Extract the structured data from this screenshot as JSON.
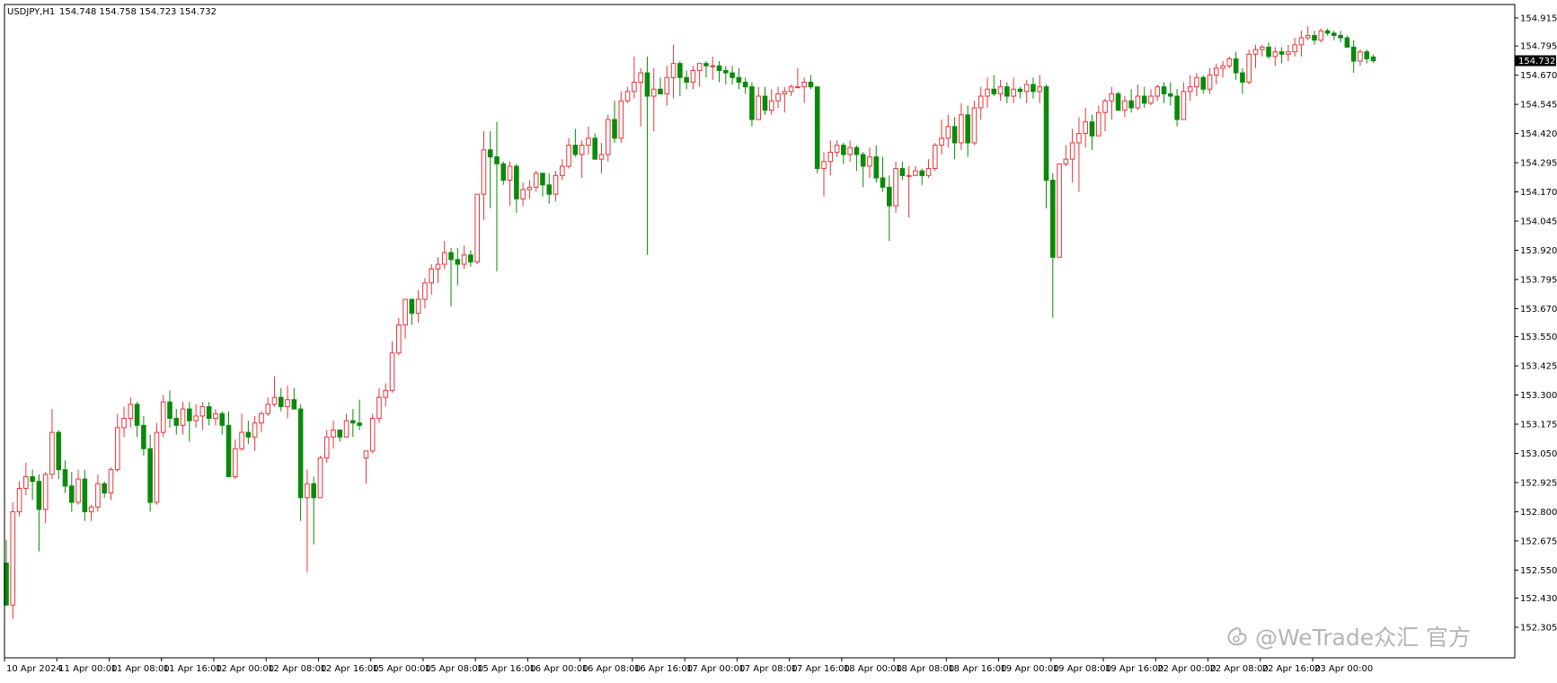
{
  "header": {
    "symbol": "USDJPY,H1",
    "ohlc": "154.748 154.758 154.723 154.732"
  },
  "watermark": {
    "text": "@WeTrade众汇 官方"
  },
  "colors": {
    "bull": "#e8343a",
    "bear": "#0a8a0a",
    "axis": "#000000",
    "tag_bg": "#000000"
  },
  "chart_data": {
    "type": "candlestick",
    "symbol": "USDJPY",
    "timeframe": "H1",
    "current_price": 154.732,
    "price_tag": "154.732",
    "ylim": [
      152.34,
      154.96
    ],
    "y_ticks": [
      "154.915",
      "154.795",
      "154.670",
      "154.545",
      "154.420",
      "154.295",
      "154.170",
      "154.045",
      "153.920",
      "153.795",
      "153.670",
      "153.550",
      "153.425",
      "153.300",
      "153.175",
      "153.050",
      "152.925",
      "152.800",
      "152.675",
      "152.550",
      "152.430",
      "152.305"
    ],
    "x_labels": [
      "10 Apr 2024",
      "11 Apr 00:00",
      "11 Apr 08:00",
      "11 Apr 16:00",
      "12 Apr 00:00",
      "12 Apr 08:00",
      "12 Apr 16:00",
      "15 Apr 00:00",
      "15 Apr 08:00",
      "15 Apr 16:00",
      "16 Apr 00:00",
      "16 Apr 08:00",
      "16 Apr 16:00",
      "17 Apr 00:00",
      "17 Apr 08:00",
      "17 Apr 16:00",
      "18 Apr 00:00",
      "18 Apr 08:00",
      "18 Apr 16:00",
      "19 Apr 00:00",
      "19 Apr 08:00",
      "19 Apr 16:00",
      "22 Apr 00:00",
      "22 Apr 08:00",
      "22 Apr 16:00",
      "23 Apr 00:00"
    ],
    "candles": [
      [
        152.58,
        152.68,
        152.4,
        152.4
      ],
      [
        152.4,
        152.84,
        152.34,
        152.8
      ],
      [
        152.8,
        152.93,
        152.78,
        152.9
      ],
      [
        152.9,
        153.01,
        152.87,
        152.95
      ],
      [
        152.95,
        152.98,
        152.85,
        152.93
      ],
      [
        152.93,
        152.96,
        152.63,
        152.81
      ],
      [
        152.81,
        152.97,
        152.75,
        152.96
      ],
      [
        152.96,
        153.24,
        152.94,
        153.14
      ],
      [
        153.14,
        153.15,
        152.94,
        152.98
      ],
      [
        152.98,
        153.02,
        152.88,
        152.91
      ],
      [
        152.91,
        152.97,
        152.8,
        152.84
      ],
      [
        152.84,
        152.98,
        152.83,
        152.94
      ],
      [
        152.94,
        152.98,
        152.76,
        152.8
      ],
      [
        152.8,
        152.83,
        152.76,
        152.82
      ],
      [
        152.82,
        152.96,
        152.8,
        152.92
      ],
      [
        152.92,
        152.93,
        152.86,
        152.88
      ],
      [
        152.88,
        152.99,
        152.85,
        152.98
      ],
      [
        152.98,
        153.22,
        152.97,
        153.16
      ],
      [
        153.16,
        153.25,
        153.12,
        153.2
      ],
      [
        153.2,
        153.29,
        153.16,
        153.26
      ],
      [
        153.26,
        153.27,
        153.12,
        153.17
      ],
      [
        153.17,
        153.21,
        153.04,
        153.07
      ],
      [
        153.07,
        153.13,
        152.8,
        152.84
      ],
      [
        152.84,
        153.18,
        152.83,
        153.14
      ],
      [
        153.14,
        153.3,
        153.12,
        153.27
      ],
      [
        153.27,
        153.32,
        153.16,
        153.2
      ],
      [
        153.2,
        153.24,
        153.13,
        153.17
      ],
      [
        153.17,
        153.27,
        153.13,
        153.24
      ],
      [
        153.24,
        153.27,
        153.1,
        153.19
      ],
      [
        153.19,
        153.26,
        153.16,
        153.21
      ],
      [
        153.21,
        153.27,
        153.15,
        153.25
      ],
      [
        153.25,
        153.27,
        153.17,
        153.2
      ],
      [
        153.2,
        153.24,
        153.17,
        153.22
      ],
      [
        153.22,
        153.23,
        153.13,
        153.17
      ],
      [
        153.17,
        153.23,
        152.95,
        152.95
      ],
      [
        152.95,
        153.11,
        152.94,
        153.07
      ],
      [
        153.07,
        153.22,
        153.06,
        153.14
      ],
      [
        153.14,
        153.19,
        153.09,
        153.12
      ],
      [
        153.12,
        153.21,
        153.06,
        153.18
      ],
      [
        153.18,
        153.23,
        153.14,
        153.22
      ],
      [
        153.22,
        153.29,
        153.21,
        153.26
      ],
      [
        153.26,
        153.38,
        153.25,
        153.29
      ],
      [
        153.29,
        153.33,
        153.23,
        153.25
      ],
      [
        153.25,
        153.34,
        153.2,
        153.28
      ],
      [
        153.28,
        153.33,
        153.24,
        153.24
      ],
      [
        153.24,
        153.26,
        152.76,
        152.86
      ],
      [
        152.86,
        152.98,
        152.54,
        152.92
      ],
      [
        152.92,
        152.95,
        152.66,
        152.86
      ],
      [
        152.86,
        153.04,
        152.86,
        153.03
      ],
      [
        153.03,
        153.15,
        153.01,
        153.12
      ],
      [
        153.12,
        153.19,
        153.07,
        153.15
      ],
      [
        153.15,
        153.14,
        153.1,
        153.12
      ],
      [
        153.12,
        153.22,
        153.12,
        153.19
      ],
      [
        153.19,
        153.24,
        153.12,
        153.18
      ],
      [
        153.18,
        153.28,
        153.15,
        153.17
      ],
      [
        153.03,
        153.06,
        152.92,
        153.06
      ],
      [
        153.06,
        153.22,
        153.05,
        153.2
      ],
      [
        153.2,
        153.33,
        153.18,
        153.29
      ],
      [
        153.29,
        153.35,
        153.25,
        153.32
      ],
      [
        153.32,
        153.53,
        153.31,
        153.48
      ],
      [
        153.48,
        153.63,
        153.47,
        153.6
      ],
      [
        153.6,
        153.71,
        153.54,
        153.71
      ],
      [
        153.71,
        153.7,
        153.6,
        153.65
      ],
      [
        153.65,
        153.75,
        153.61,
        153.71
      ],
      [
        153.71,
        153.8,
        153.67,
        153.78
      ],
      [
        153.78,
        153.86,
        153.73,
        153.84
      ],
      [
        153.84,
        153.89,
        153.78,
        153.86
      ],
      [
        153.86,
        153.96,
        153.84,
        153.91
      ],
      [
        153.91,
        153.93,
        153.68,
        153.88
      ],
      [
        153.88,
        153.93,
        153.77,
        153.86
      ],
      [
        153.86,
        153.94,
        153.84,
        153.9
      ],
      [
        153.9,
        153.92,
        153.85,
        153.87
      ],
      [
        153.87,
        154.16,
        153.86,
        154.16
      ],
      [
        154.16,
        154.43,
        154.05,
        154.35
      ],
      [
        154.35,
        154.43,
        154.1,
        154.32
      ],
      [
        154.32,
        154.47,
        153.83,
        154.29
      ],
      [
        154.29,
        154.3,
        154.2,
        154.22
      ],
      [
        154.22,
        154.3,
        154.11,
        154.28
      ],
      [
        154.28,
        154.29,
        154.08,
        154.14
      ],
      [
        154.14,
        154.21,
        154.11,
        154.18
      ],
      [
        154.18,
        154.22,
        154.14,
        154.19
      ],
      [
        154.19,
        154.26,
        154.17,
        154.25
      ],
      [
        154.25,
        154.25,
        154.15,
        154.2
      ],
      [
        154.2,
        154.25,
        154.12,
        154.16
      ],
      [
        154.16,
        154.26,
        154.13,
        154.24
      ],
      [
        154.24,
        154.31,
        154.22,
        154.28
      ],
      [
        154.28,
        154.4,
        154.27,
        154.37
      ],
      [
        154.37,
        154.44,
        154.32,
        154.33
      ],
      [
        154.33,
        154.39,
        154.23,
        154.37
      ],
      [
        154.37,
        154.45,
        154.33,
        154.4
      ],
      [
        154.4,
        154.42,
        154.31,
        154.31
      ],
      [
        154.31,
        154.38,
        154.25,
        154.33
      ],
      [
        154.33,
        154.5,
        154.3,
        154.48
      ],
      [
        154.48,
        154.56,
        154.38,
        154.4
      ],
      [
        154.4,
        154.6,
        154.38,
        154.56
      ],
      [
        154.56,
        154.62,
        154.55,
        154.6
      ],
      [
        154.6,
        154.75,
        154.57,
        154.64
      ],
      [
        154.64,
        154.7,
        154.45,
        154.68
      ],
      [
        154.68,
        154.75,
        153.9,
        154.58
      ],
      [
        154.58,
        154.7,
        154.43,
        154.61
      ],
      [
        154.61,
        154.66,
        154.59,
        154.59
      ],
      [
        154.59,
        154.71,
        154.54,
        154.66
      ],
      [
        154.66,
        154.8,
        154.57,
        154.72
      ],
      [
        154.72,
        154.73,
        154.58,
        154.66
      ],
      [
        154.66,
        154.69,
        154.61,
        154.64
      ],
      [
        154.64,
        154.71,
        154.61,
        154.69
      ],
      [
        154.69,
        154.72,
        154.62,
        154.72
      ],
      [
        154.72,
        154.73,
        154.66,
        154.71
      ],
      [
        154.71,
        154.75,
        154.65,
        154.71
      ],
      [
        154.71,
        154.73,
        154.64,
        154.69
      ],
      [
        154.69,
        154.71,
        154.63,
        154.68
      ],
      [
        154.68,
        154.71,
        154.63,
        154.66
      ],
      [
        154.66,
        154.7,
        154.61,
        154.64
      ],
      [
        154.64,
        154.66,
        154.59,
        154.62
      ],
      [
        154.62,
        154.64,
        154.45,
        154.48
      ],
      [
        154.48,
        154.62,
        154.48,
        154.58
      ],
      [
        154.58,
        154.62,
        154.5,
        154.52
      ],
      [
        154.52,
        154.61,
        154.5,
        154.56
      ],
      [
        154.56,
        154.62,
        154.53,
        154.59
      ],
      [
        154.59,
        154.62,
        154.51,
        154.6
      ],
      [
        154.6,
        154.63,
        154.58,
        154.62
      ],
      [
        154.62,
        154.7,
        154.62,
        154.62
      ],
      [
        154.62,
        154.66,
        154.55,
        154.64
      ],
      [
        154.64,
        154.67,
        154.61,
        154.62
      ],
      [
        154.62,
        154.62,
        154.25,
        154.27
      ],
      [
        154.27,
        154.34,
        154.15,
        154.3
      ],
      [
        154.3,
        154.39,
        154.24,
        154.34
      ],
      [
        154.34,
        154.39,
        154.32,
        154.37
      ],
      [
        154.37,
        154.38,
        154.29,
        154.33
      ],
      [
        154.33,
        154.39,
        154.3,
        154.36
      ],
      [
        154.36,
        154.37,
        154.26,
        154.33
      ],
      [
        154.33,
        154.34,
        154.19,
        154.28
      ],
      [
        154.28,
        154.36,
        154.23,
        154.32
      ],
      [
        154.32,
        154.37,
        154.21,
        154.23
      ],
      [
        154.23,
        154.32,
        154.17,
        154.19
      ],
      [
        154.19,
        154.24,
        153.96,
        154.11
      ],
      [
        154.11,
        154.3,
        154.08,
        154.27
      ],
      [
        154.27,
        154.3,
        154.22,
        154.24
      ],
      [
        154.24,
        154.28,
        154.06,
        154.24
      ],
      [
        154.24,
        154.28,
        154.24,
        154.26
      ],
      [
        154.26,
        154.27,
        154.2,
        154.24
      ],
      [
        154.24,
        154.31,
        154.23,
        154.27
      ],
      [
        154.27,
        154.38,
        154.26,
        154.37
      ],
      [
        154.37,
        154.48,
        154.33,
        154.4
      ],
      [
        154.4,
        154.5,
        154.36,
        154.45
      ],
      [
        154.45,
        154.49,
        154.31,
        154.38
      ],
      [
        154.38,
        154.55,
        154.35,
        154.5
      ],
      [
        154.5,
        154.54,
        154.32,
        154.38
      ],
      [
        154.38,
        154.56,
        154.37,
        154.53
      ],
      [
        154.53,
        154.62,
        154.48,
        154.58
      ],
      [
        154.58,
        154.66,
        154.53,
        154.61
      ],
      [
        154.61,
        154.67,
        154.58,
        154.59
      ],
      [
        154.59,
        154.65,
        154.56,
        154.62
      ],
      [
        154.62,
        154.64,
        154.55,
        154.58
      ],
      [
        154.58,
        154.66,
        154.55,
        154.61
      ],
      [
        154.61,
        154.62,
        154.57,
        154.6
      ],
      [
        154.6,
        154.65,
        154.55,
        154.63
      ],
      [
        154.63,
        154.66,
        154.57,
        154.6
      ],
      [
        154.6,
        154.67,
        154.55,
        154.62
      ],
      [
        154.62,
        154.63,
        154.1,
        154.22
      ],
      [
        154.22,
        154.25,
        153.63,
        153.89
      ],
      [
        153.89,
        154.29,
        153.89,
        154.29
      ],
      [
        154.29,
        154.37,
        154.28,
        154.31
      ],
      [
        154.31,
        154.44,
        154.21,
        154.38
      ],
      [
        154.38,
        154.49,
        154.17,
        154.42
      ],
      [
        154.42,
        154.53,
        154.36,
        154.47
      ],
      [
        154.47,
        154.5,
        154.35,
        154.41
      ],
      [
        154.41,
        154.54,
        154.41,
        154.51
      ],
      [
        154.51,
        154.57,
        154.43,
        154.56
      ],
      [
        154.56,
        154.62,
        154.48,
        154.59
      ],
      [
        154.59,
        154.6,
        154.52,
        154.52
      ],
      [
        154.52,
        154.58,
        154.49,
        154.56
      ],
      [
        154.56,
        154.61,
        154.51,
        154.53
      ],
      [
        154.53,
        154.63,
        154.52,
        154.58
      ],
      [
        154.58,
        154.62,
        154.53,
        154.55
      ],
      [
        154.55,
        154.61,
        154.54,
        154.58
      ],
      [
        154.58,
        154.63,
        154.56,
        154.62
      ],
      [
        154.62,
        154.64,
        154.55,
        154.59
      ],
      [
        154.59,
        154.64,
        154.54,
        154.58
      ],
      [
        154.58,
        154.61,
        154.45,
        154.48
      ],
      [
        154.48,
        154.64,
        154.48,
        154.6
      ],
      [
        154.6,
        154.67,
        154.56,
        154.62
      ],
      [
        154.62,
        154.68,
        154.58,
        154.66
      ],
      [
        154.66,
        154.67,
        154.59,
        154.61
      ],
      [
        154.61,
        154.7,
        154.59,
        154.67
      ],
      [
        154.67,
        154.72,
        154.63,
        154.7
      ],
      [
        154.7,
        154.73,
        154.66,
        154.71
      ],
      [
        154.71,
        154.75,
        154.7,
        154.74
      ],
      [
        154.74,
        154.77,
        154.65,
        154.68
      ],
      [
        154.68,
        154.7,
        154.59,
        154.64
      ],
      [
        154.64,
        154.78,
        154.63,
        154.76
      ],
      [
        154.76,
        154.8,
        154.7,
        154.78
      ],
      [
        154.78,
        154.8,
        154.75,
        154.79
      ],
      [
        154.79,
        154.81,
        154.74,
        154.75
      ],
      [
        154.75,
        154.79,
        154.71,
        154.77
      ],
      [
        154.77,
        154.79,
        154.72,
        154.76
      ],
      [
        154.76,
        154.8,
        154.73,
        154.77
      ],
      [
        154.77,
        154.83,
        154.75,
        154.8
      ],
      [
        154.8,
        154.86,
        154.75,
        154.83
      ],
      [
        154.83,
        154.88,
        154.82,
        154.84
      ],
      [
        154.84,
        154.86,
        154.8,
        154.82
      ],
      [
        154.82,
        154.87,
        154.81,
        154.86
      ],
      [
        154.86,
        154.87,
        154.84,
        154.85
      ],
      [
        154.85,
        154.86,
        154.82,
        154.84
      ],
      [
        154.84,
        154.86,
        154.81,
        154.83
      ],
      [
        154.83,
        154.84,
        154.79,
        154.79
      ],
      [
        154.79,
        154.82,
        154.68,
        154.73
      ],
      [
        154.73,
        154.78,
        154.71,
        154.77
      ],
      [
        154.77,
        154.78,
        154.72,
        154.74
      ],
      [
        154.748,
        154.758,
        154.723,
        154.732
      ]
    ]
  }
}
